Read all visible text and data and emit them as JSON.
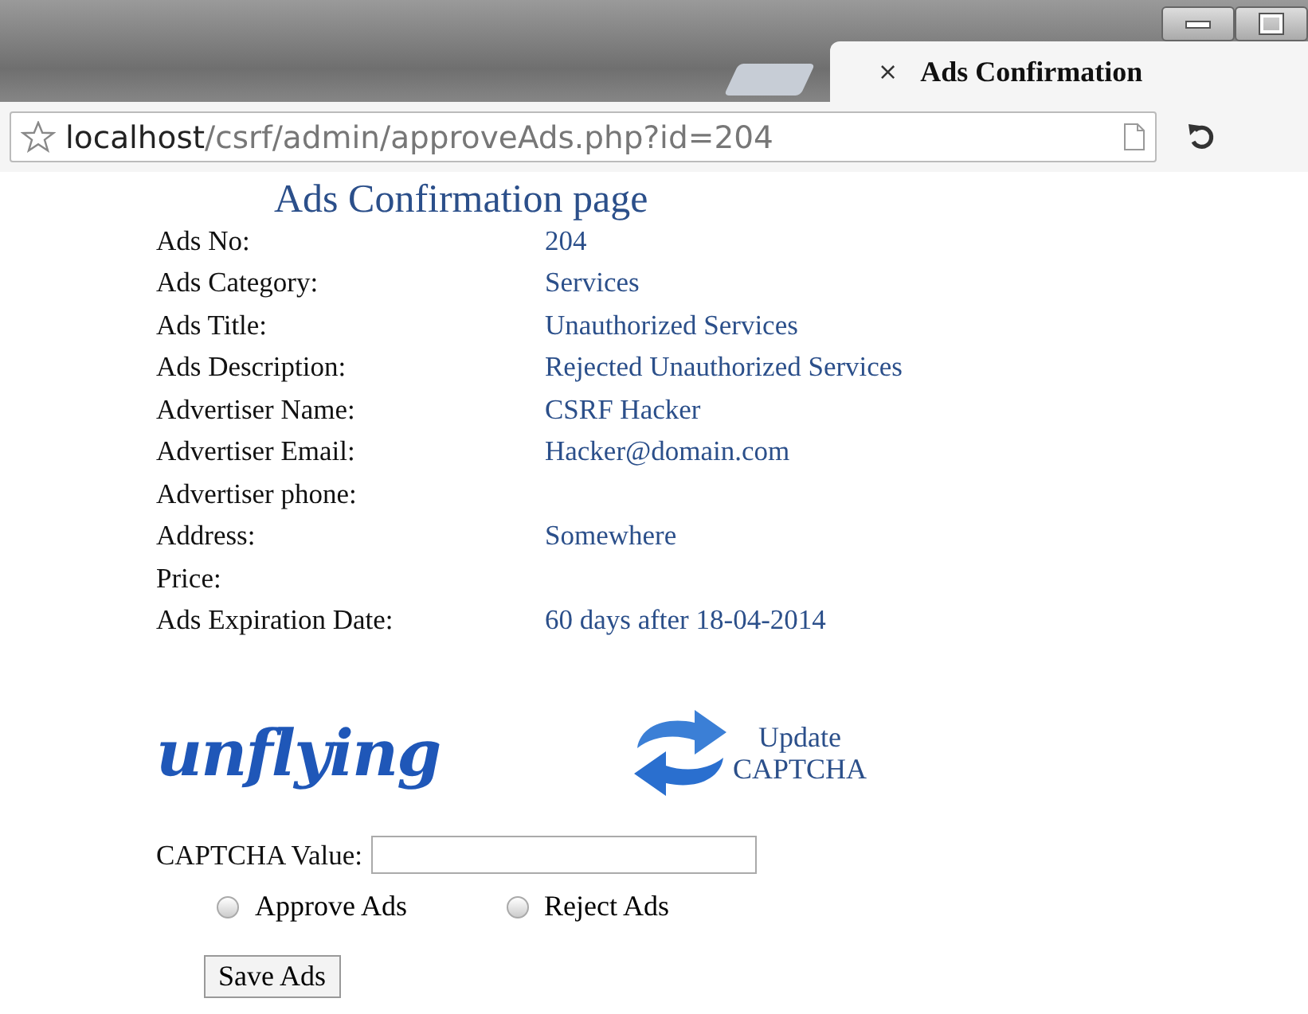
{
  "browser": {
    "tab": {
      "close": "×",
      "title": "Ads Confirmation",
      "selected": true
    },
    "address": {
      "host": "localhost",
      "path": "/csrf/admin/approveAds.php?id=204"
    }
  },
  "page": {
    "title": "Ads Confirmation page",
    "fields": [
      {
        "label": "Ads No:",
        "value": "204"
      },
      {
        "label": "Ads Category:",
        "value": "Services"
      },
      {
        "label": "Ads Title:",
        "value": "Unauthorized Services"
      },
      {
        "label": "Ads Description:",
        "value": "Rejected Unauthorized Services"
      },
      {
        "label": "Advertiser Name:",
        "value": "CSRF Hacker"
      },
      {
        "label": "Advertiser Email:",
        "value": "Hacker@domain.com"
      },
      {
        "label": "Advertiser phone:"
      },
      {
        "label": "Address:",
        "value": "Somewhere"
      },
      {
        "label": "Price:"
      },
      {
        "label": "Ads Expiration Date:",
        "value": "60 days after 18-04-2014"
      }
    ],
    "captcha": {
      "image_text": "unflying",
      "update": [
        "Update",
        "CAPTCHA"
      ],
      "label": "CAPTCHA Value:"
    },
    "decision": [
      {
        "label": "Approve Ads",
        "selected": false
      },
      {
        "label": "Reject Ads",
        "selected": false
      }
    ],
    "save_button": "Save Ads"
  }
}
